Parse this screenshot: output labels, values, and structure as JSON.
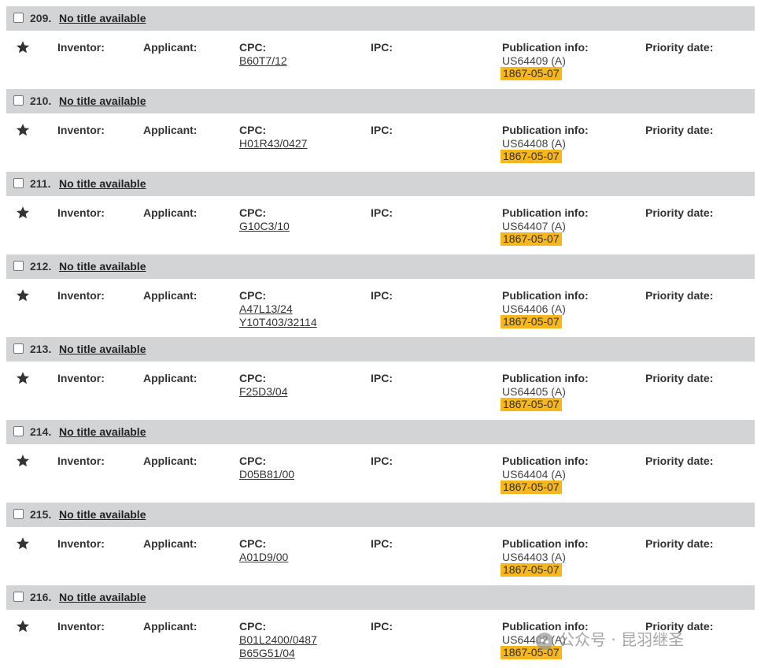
{
  "labels": {
    "inventor": "Inventor:",
    "applicant": "Applicant:",
    "cpc": "CPC:",
    "ipc": "IPC:",
    "publication_info": "Publication info:",
    "priority_date": "Priority date:"
  },
  "results": [
    {
      "number": "209.",
      "title": "No title available",
      "cpc": [
        "B60T7/12"
      ],
      "publication_number": "US64409 (A)",
      "publication_date": "1867-05-07"
    },
    {
      "number": "210.",
      "title": "No title available",
      "cpc": [
        "H01R43/0427"
      ],
      "publication_number": "US64408 (A)",
      "publication_date": "1867-05-07"
    },
    {
      "number": "211.",
      "title": "No title available",
      "cpc": [
        "G10C3/10"
      ],
      "publication_number": "US64407 (A)",
      "publication_date": "1867-05-07"
    },
    {
      "number": "212.",
      "title": "No title available",
      "cpc": [
        "A47L13/24",
        "Y10T403/32114"
      ],
      "publication_number": "US64406 (A)",
      "publication_date": "1867-05-07"
    },
    {
      "number": "213.",
      "title": "No title available",
      "cpc": [
        "F25D3/04"
      ],
      "publication_number": "US64405 (A)",
      "publication_date": "1867-05-07"
    },
    {
      "number": "214.",
      "title": "No title available",
      "cpc": [
        "D05B81/00"
      ],
      "publication_number": "US64404 (A)",
      "publication_date": "1867-05-07"
    },
    {
      "number": "215.",
      "title": "No title available",
      "cpc": [
        "A01D9/00"
      ],
      "publication_number": "US64403 (A)",
      "publication_date": "1867-05-07"
    },
    {
      "number": "216.",
      "title": "No title available",
      "cpc": [
        "B01L2400/0487",
        "B65G51/04"
      ],
      "publication_number": "US64402 (A)",
      "publication_date": "1867-05-07"
    }
  ],
  "watermark": {
    "text": "公众号 · 昆羽继圣",
    "icon": "wechat-icon"
  },
  "colors": {
    "header_bg": "#d3d4d6",
    "date_highlight": "#f6b61c"
  }
}
